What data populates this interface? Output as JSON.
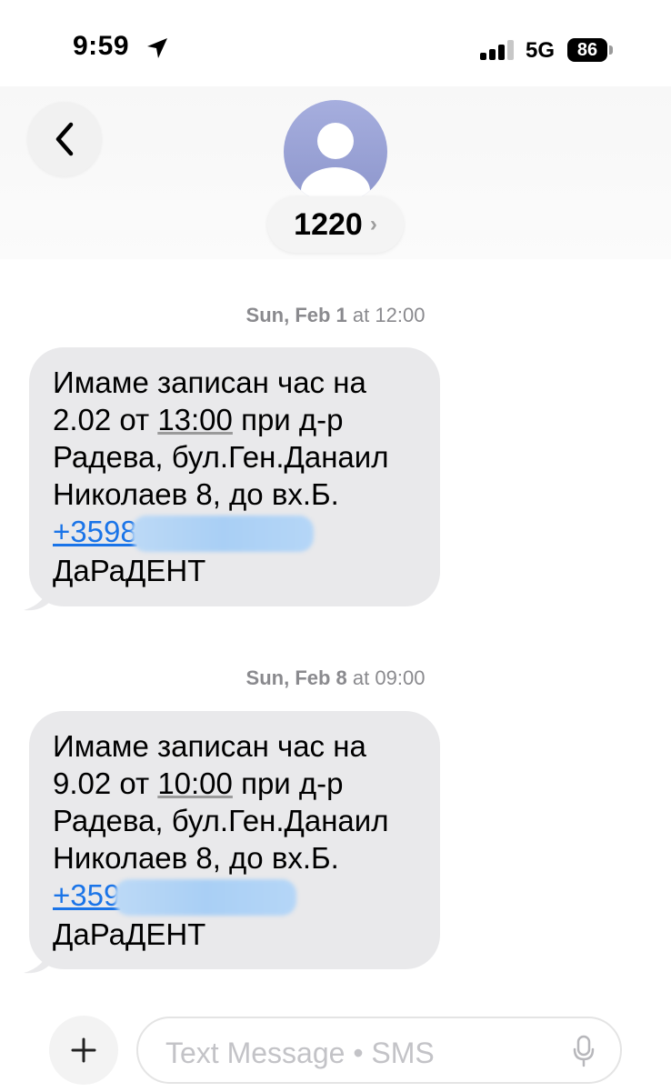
{
  "status_bar": {
    "time": "9:59",
    "network": "5G",
    "battery": "86"
  },
  "header": {
    "contact": "1220",
    "chevron": "›"
  },
  "messages": [
    {
      "timestamp_day": "Sun, Feb 1",
      "timestamp_time": "at 12:00",
      "line1": "Имаме записан час на",
      "line2_pre": "2.02 от ",
      "line2_time": "13:00",
      "line2_post": " при д-р",
      "line3": "Радева, бул.Ген.Данаил",
      "line4": "Николаев 8, до вх.Б.",
      "phone": "+3598",
      "sender": "ДаРаДЕНТ"
    },
    {
      "timestamp_day": "Sun, Feb 8",
      "timestamp_time": "at 09:00",
      "line1": "Имаме записан час на",
      "line2_pre": "9.02 от ",
      "line2_time": "10:00",
      "line2_post": " при д-р",
      "line3": "Радева, бул.Ген.Данаил",
      "line4": "Николаев 8, до вх.Б.",
      "phone": "+359",
      "sender": "ДаРаДЕНТ"
    }
  ],
  "composer": {
    "placeholder": "Text Message • SMS",
    "plus": "+"
  },
  "colors": {
    "bubble": "#e9e9eb",
    "link": "#1a74e8",
    "avatar": "#97a0d6"
  }
}
